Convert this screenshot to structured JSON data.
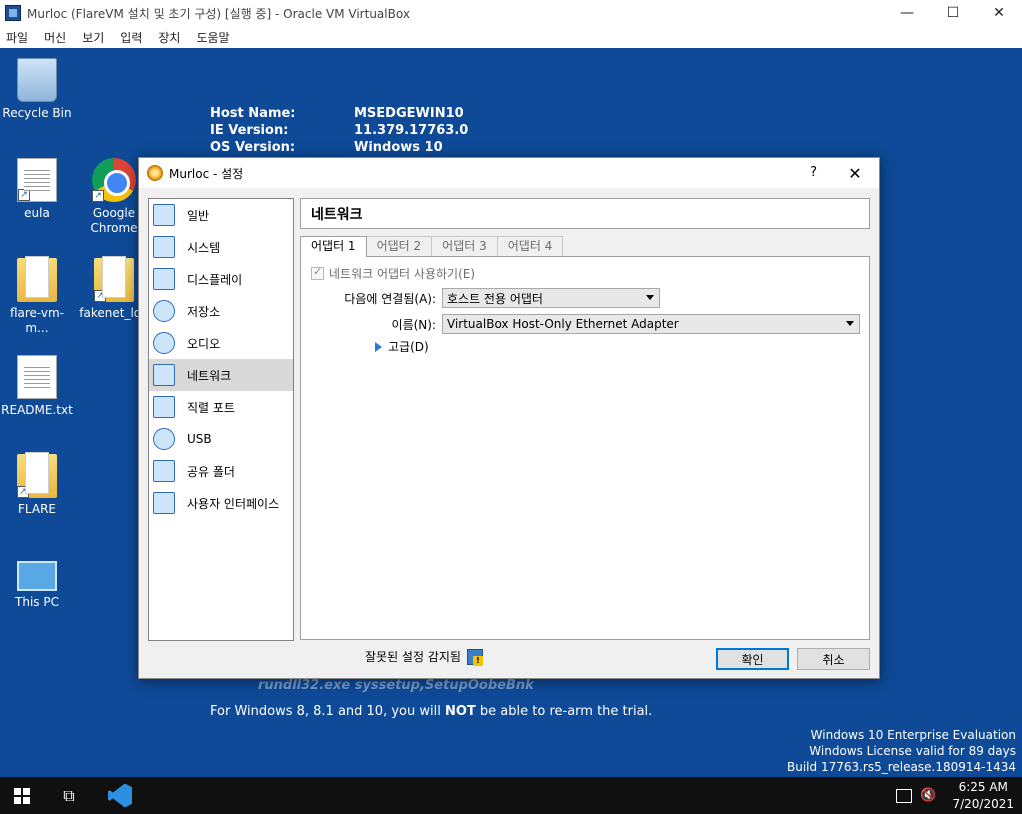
{
  "window": {
    "title": "Murloc (FlareVM 설치 및 초기 구성) [실행 중] - Oracle VM VirtualBox",
    "minimize": "—",
    "maximize": "☐",
    "close": "✕"
  },
  "menubar": [
    "파일",
    "머신",
    "보기",
    "입력",
    "장치",
    "도움말"
  ],
  "desktop": {
    "icons": [
      {
        "label": "Recycle Bin",
        "icon": "recycle-bin-icon"
      },
      {
        "label": "eula",
        "icon": "text-document-icon"
      },
      {
        "label": "Google Chrome",
        "icon": "chrome-icon"
      },
      {
        "label": "flare-vm-m...",
        "icon": "folder-icon"
      },
      {
        "label": "fakenet_log",
        "icon": "folder-icon"
      },
      {
        "label": "README.txt",
        "icon": "text-document-icon"
      },
      {
        "label": "FLARE",
        "icon": "folder-icon"
      },
      {
        "label": "This PC",
        "icon": "computer-icon"
      }
    ],
    "bginfo": [
      {
        "label": "Host Name:",
        "value": "MSEDGEWIN10"
      },
      {
        "label": "IE Version:",
        "value": "11.379.17763.0"
      },
      {
        "label": "OS Version:",
        "value": "Windows 10"
      }
    ],
    "cut_text": "rundll32.exe syssetup,SetupOobeBnk",
    "bottom_text_pre": "For Windows 8, 8.1 and 10, you will ",
    "bottom_text_bold": "NOT",
    "bottom_text_post": " be able to re-arm the trial.",
    "watermark": [
      "Windows 10 Enterprise Evaluation",
      "Windows License valid for 89 days",
      "Build 17763.rs5_release.180914-1434"
    ]
  },
  "dialog": {
    "title": "Murloc - 설정",
    "help": "?",
    "close": "✕",
    "sidebar": [
      {
        "label": "일반",
        "selected": false
      },
      {
        "label": "시스템",
        "selected": false
      },
      {
        "label": "디스플레이",
        "selected": false
      },
      {
        "label": "저장소",
        "selected": false
      },
      {
        "label": "오디오",
        "selected": false
      },
      {
        "label": "네트워크",
        "selected": true
      },
      {
        "label": "직렬 포트",
        "selected": false
      },
      {
        "label": "USB",
        "selected": false
      },
      {
        "label": "공유 폴더",
        "selected": false
      },
      {
        "label": "사용자 인터페이스",
        "selected": false
      }
    ],
    "page_title": "네트워크",
    "tabs": [
      "어댑터 1",
      "어댑터 2",
      "어댑터 3",
      "어댑터 4"
    ],
    "enable_adapter_label": "네트워크 어댑터 사용하기(E)",
    "attached_label": "다음에 연결됨(A):",
    "attached_value": "호스트 전용 어댑터",
    "name_label": "이름(N):",
    "name_value": "VirtualBox Host-Only Ethernet Adapter",
    "advanced_label": "고급(D)",
    "warning_label": "잘못된 설정 감지됨",
    "ok_label": "확인",
    "cancel_label": "취소"
  },
  "taskbar": {
    "time": "6:25 AM",
    "date": "7/20/2021"
  }
}
